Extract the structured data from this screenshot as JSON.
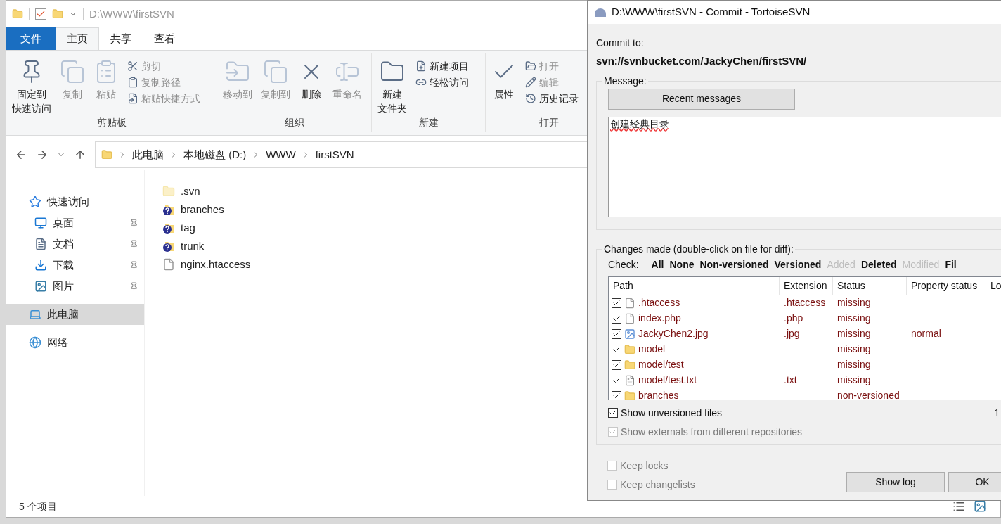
{
  "explorer": {
    "title": "D:\\WWW\\firstSVN",
    "ribbon_tabs": [
      {
        "label": "文件",
        "kind": "file"
      },
      {
        "label": "主页",
        "selected": true,
        "kind": "tab"
      },
      {
        "label": "共享",
        "selected": false,
        "kind": "tab"
      },
      {
        "label": "查看",
        "selected": false,
        "kind": "tab"
      }
    ],
    "ribbon_groups": [
      {
        "label": "剪贴板",
        "items": [
          {
            "lines": [
              "固定到",
              "快速访问"
            ],
            "kind": "large",
            "disabled": false
          },
          {
            "lines": [
              "复制"
            ],
            "kind": "large",
            "disabled": true
          },
          {
            "lines": [
              "粘贴"
            ],
            "kind": "large",
            "disabled": true
          },
          {
            "label": "剪切",
            "kind": "small",
            "disabled": true
          },
          {
            "label": "复制路径",
            "kind": "small",
            "disabled": true
          },
          {
            "label": "粘贴快捷方式",
            "kind": "small",
            "disabled": true
          }
        ]
      },
      {
        "label": "组织",
        "items": [
          {
            "lines": [
              "移动到"
            ],
            "kind": "large",
            "disabled": true
          },
          {
            "lines": [
              "复制到"
            ],
            "kind": "large",
            "disabled": true
          },
          {
            "lines": [
              "删除"
            ],
            "kind": "large",
            "disabled": false
          },
          {
            "lines": [
              "重命名"
            ],
            "kind": "large",
            "disabled": true
          }
        ]
      },
      {
        "label": "新建",
        "items": [
          {
            "lines": [
              "新建",
              "文件夹"
            ],
            "kind": "large",
            "disabled": false
          },
          {
            "label": "新建项目",
            "kind": "small",
            "disabled": false
          },
          {
            "label": "轻松访问",
            "kind": "small",
            "disabled": false
          }
        ]
      },
      {
        "label": "打开",
        "items": [
          {
            "lines": [
              "属性"
            ],
            "kind": "large",
            "disabled": false
          },
          {
            "label": "打开",
            "kind": "small",
            "disabled": true
          },
          {
            "label": "编辑",
            "kind": "small",
            "disabled": true
          },
          {
            "label": "历史记录",
            "kind": "small",
            "disabled": false
          }
        ]
      }
    ],
    "breadcrumb": [
      "此电脑",
      "本地磁盘 (D:)",
      "WWW",
      "firstSVN"
    ],
    "nav": [
      {
        "label": "快速访问",
        "kind": "header",
        "selected": false
      },
      {
        "label": "桌面",
        "kind": "pinned",
        "selected": false
      },
      {
        "label": "文档",
        "kind": "pinned",
        "selected": false
      },
      {
        "label": "下载",
        "kind": "pinned",
        "selected": false
      },
      {
        "label": "图片",
        "kind": "pinned",
        "selected": false
      },
      {
        "label": "此电脑",
        "kind": "header",
        "selected": true
      },
      {
        "label": "网络",
        "kind": "header",
        "selected": false
      }
    ],
    "files": [
      {
        "name": ".svn",
        "kind": "hidden_folder"
      },
      {
        "name": "branches",
        "kind": "unversioned_folder"
      },
      {
        "name": "tag",
        "kind": "unversioned_folder"
      },
      {
        "name": "trunk",
        "kind": "unversioned_folder"
      },
      {
        "name": "nginx.htaccess",
        "kind": "file"
      }
    ],
    "status": "5 个项目"
  },
  "dialog": {
    "title": "D:\\WWW\\firstSVN - Commit - TortoiseSVN",
    "commit_to_label": "Commit to:",
    "url": "svn://svnbucket.com/JackyChen/firstSVN/",
    "message_label": "Message:",
    "recent_button": "Recent messages",
    "message": "创建经典目录",
    "changes_label": "Changes made (double-click on file for diff):",
    "check_label": "Check:",
    "filters": [
      {
        "label": "All",
        "disabled": false
      },
      {
        "label": "None",
        "disabled": false
      },
      {
        "label": "Non-versioned",
        "disabled": false
      },
      {
        "label": "Versioned",
        "disabled": false
      },
      {
        "label": "Added",
        "disabled": true
      },
      {
        "label": "Deleted",
        "disabled": false
      },
      {
        "label": "Modified",
        "disabled": true
      },
      {
        "label": "Fil",
        "disabled": false
      }
    ],
    "columns": [
      "Path",
      "Extension",
      "Status",
      "Property status",
      "Lo"
    ],
    "rows": [
      {
        "checked": true,
        "kind": "file",
        "path": ".htaccess",
        "extension": ".htaccess",
        "status": "missing"
      },
      {
        "checked": true,
        "kind": "file",
        "path": "index.php",
        "extension": ".php",
        "status": "missing"
      },
      {
        "checked": true,
        "kind": "image",
        "path": "JackyChen2.jpg",
        "extension": ".jpg",
        "status": "missing",
        "property_status": "normal"
      },
      {
        "checked": true,
        "kind": "folder",
        "path": "model",
        "status": "missing"
      },
      {
        "checked": true,
        "kind": "folder",
        "path": "model/test",
        "status": "missing"
      },
      {
        "checked": true,
        "kind": "text",
        "path": "model/test.txt",
        "extension": ".txt",
        "status": "missing"
      },
      {
        "checked": true,
        "kind": "folder",
        "path": "branches",
        "status": "non-versioned"
      }
    ],
    "count": "1",
    "options": [
      {
        "label": "Show unversioned files",
        "checked": true,
        "disabled": false
      },
      {
        "label": "Show externals from different repositories",
        "checked": true,
        "disabled": true
      }
    ],
    "keep": [
      {
        "label": "Keep locks",
        "checked": false,
        "disabled": true
      },
      {
        "label": "Keep changelists",
        "checked": false,
        "disabled": true
      }
    ],
    "buttons": [
      "Show log",
      "OK"
    ]
  }
}
